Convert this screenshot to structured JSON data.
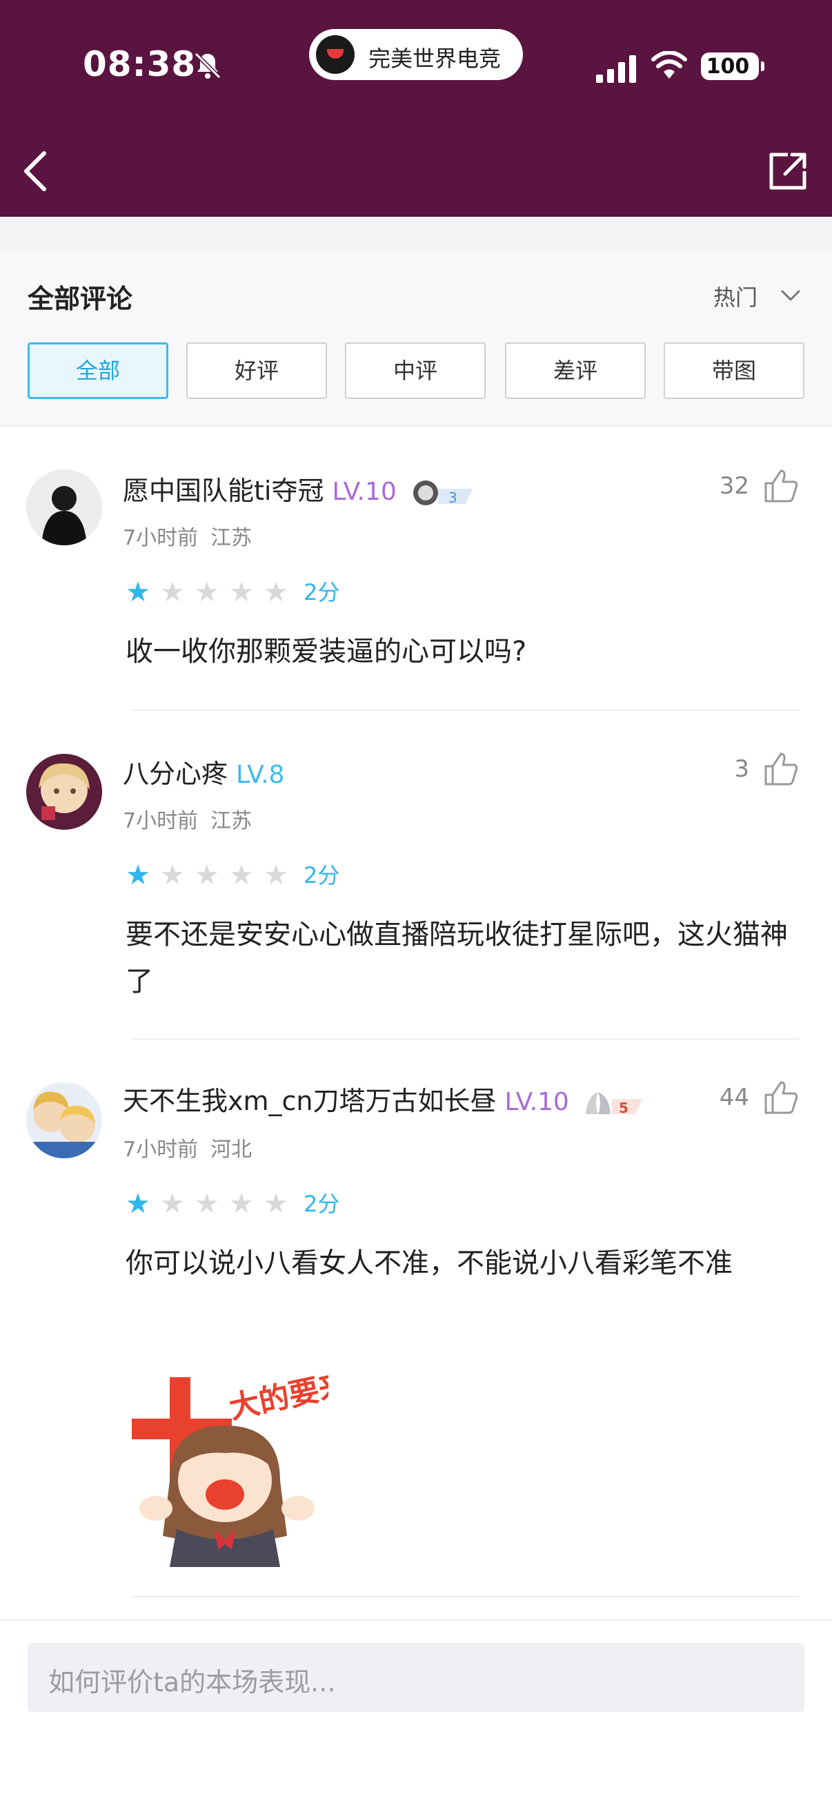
{
  "status_bar": {
    "time": "08:38",
    "app_name": "完美世界电竞",
    "battery": "100"
  },
  "header": {
    "back_icon": "chevron-left-icon",
    "share_icon": "share-external-icon",
    "background_color": "#5a1440"
  },
  "reviews": {
    "title": "全部评论",
    "sort_label": "热门",
    "tabs": [
      {
        "label": "全部",
        "active": true
      },
      {
        "label": "好评",
        "active": false
      },
      {
        "label": "中评",
        "active": false
      },
      {
        "label": "差评",
        "active": false
      },
      {
        "label": "带图",
        "active": false
      }
    ],
    "accent_color": "#3fb9ea"
  },
  "comments": [
    {
      "username": "愿中国队能ti夺冠",
      "level": "LV.10",
      "badge_num": "3",
      "time": "7小时前",
      "location": "江苏",
      "likes": "32",
      "rating": 1,
      "score": "2分",
      "text": "收一收你那颗爱装逼的心可以吗?"
    },
    {
      "username": "八分心疼",
      "level": "LV.8",
      "time": "7小时前",
      "location": "江苏",
      "likes": "3",
      "rating": 1,
      "score": "2分",
      "text": "要不还是安安心心做直播陪玩收徒打星际吧，这火猫神了"
    },
    {
      "username": "天不生我xm_cn刀塔万古如长昼",
      "level": "LV.10",
      "badge_num": "5",
      "time": "7小时前",
      "location": "河北",
      "likes": "44",
      "rating": 1,
      "score": "2分",
      "text": "你可以说小八看女人不准，不能说小八看彩笔不准",
      "sticker_text": "大的要来了!"
    }
  ],
  "composer": {
    "placeholder": "如何评价ta的本场表现..."
  }
}
